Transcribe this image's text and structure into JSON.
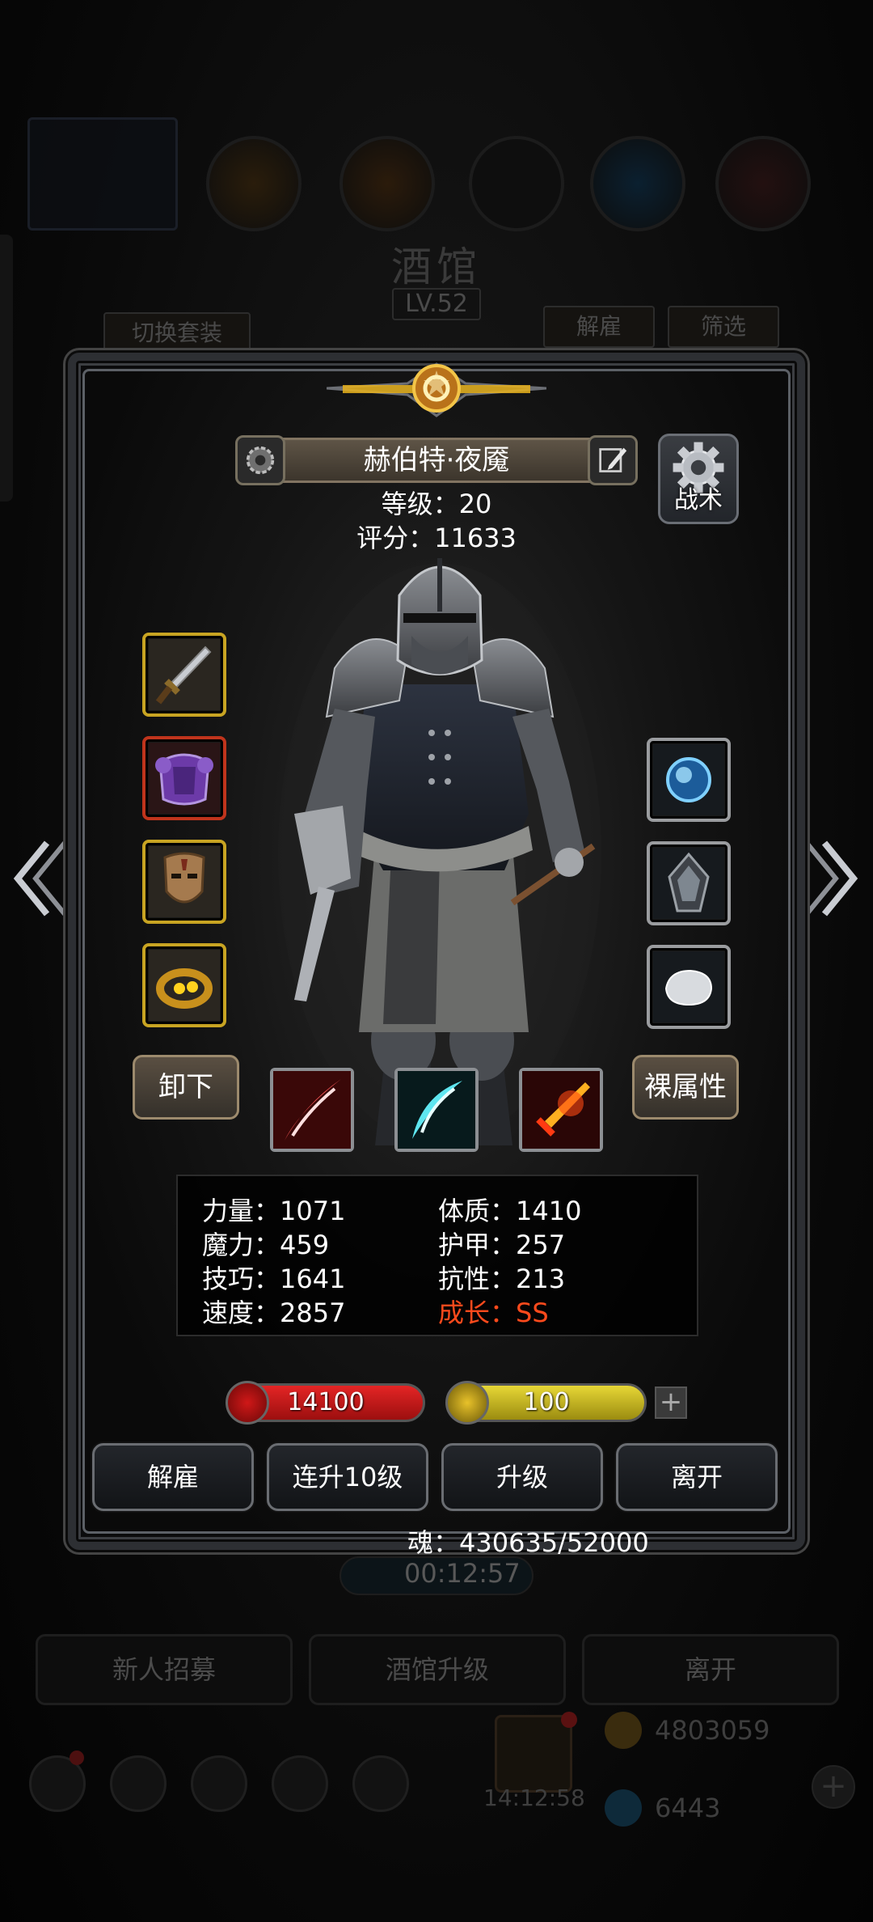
{
  "background": {
    "title": "酒馆",
    "level": "LV.52",
    "switch_outfit": "切换套装",
    "dismiss": "解雇",
    "filter": "筛选",
    "timer": "00:12:57",
    "bottom_buttons": [
      "新人招募",
      "酒馆升级",
      "离开"
    ],
    "gold": "4803059",
    "gems": "6443",
    "clock": "14:12:58"
  },
  "hero": {
    "name": "赫伯特·夜魇",
    "level_text": "等级：20",
    "score_text": "评分：11633",
    "tactics_label": "战术"
  },
  "equipment_left": [
    {
      "slot": "weapon",
      "icon": "dagger-icon",
      "rarity_color": "#c8a422"
    },
    {
      "slot": "armor",
      "icon": "purple-armor-icon",
      "rarity_color": "#c0341c"
    },
    {
      "slot": "helmet",
      "icon": "mask-icon",
      "rarity_color": "#c8a422"
    },
    {
      "slot": "ring",
      "icon": "gold-ring-icon",
      "rarity_color": "#c8a422"
    }
  ],
  "equipment_right": [
    {
      "slot": "amulet",
      "icon": "blue-orb-amulet-icon",
      "rarity_color": "#9a9c9f"
    },
    {
      "slot": "mirror",
      "icon": "mirror-charm-icon",
      "rarity_color": "#9a9c9f"
    },
    {
      "slot": "stone",
      "icon": "white-stone-icon",
      "rarity_color": "#9a9c9f"
    }
  ],
  "actions": {
    "unequip": "卸下",
    "base_attributes": "裸属性"
  },
  "skills": [
    {
      "icon": "red-slash-skill-icon"
    },
    {
      "icon": "cyan-slash-skill-icon"
    },
    {
      "icon": "fire-sword-skill-icon"
    }
  ],
  "stats": {
    "strength": "力量：1071",
    "constitution": "体质：1410",
    "magic": "魔力：459",
    "armor": "护甲：257",
    "skill": "技巧：1641",
    "resistance": "抗性：213",
    "speed": "速度：2857",
    "growth": "成长：SS"
  },
  "bars": {
    "hp": "14100",
    "energy": "100",
    "plus": "+"
  },
  "buttons": {
    "dismiss": "解雇",
    "level_up_10": "连升10级",
    "level_up": "升级",
    "leave": "离开"
  },
  "souls": "魂：430635/52000",
  "colors": {
    "gold_rarity": "#c8a422",
    "red_rarity": "#c0341c",
    "growth_text": "#ff4a1c",
    "hp": "#e42525",
    "energy": "#e7d736"
  }
}
